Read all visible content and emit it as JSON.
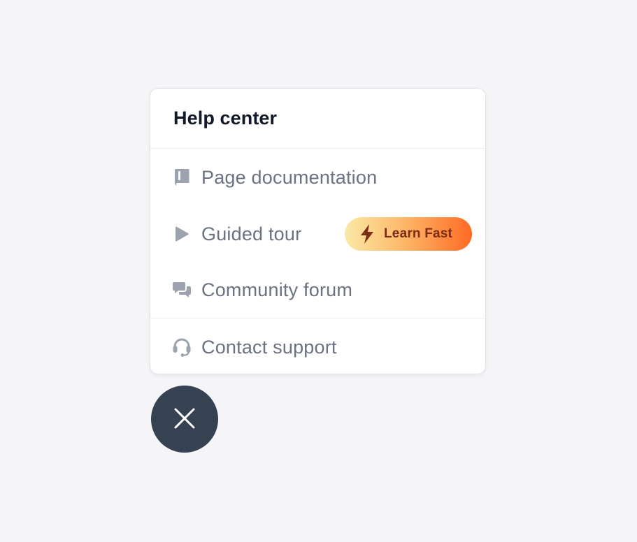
{
  "help_center": {
    "title": "Help center",
    "items": [
      {
        "label": "Page documentation",
        "icon": "book-icon"
      },
      {
        "label": "Guided tour",
        "icon": "play-icon",
        "badge": {
          "label": "Learn Fast",
          "icon": "lightning-bolt-icon"
        }
      },
      {
        "label": "Community forum",
        "icon": "chat-bubbles-icon"
      }
    ],
    "support_items": [
      {
        "label": "Contact support",
        "icon": "headset-icon"
      }
    ]
  },
  "close_button": {
    "icon": "close-icon"
  },
  "colors": {
    "background": "#f5f5f7",
    "panel": "#ffffff",
    "title_text": "#111827",
    "item_text": "#6b7280",
    "icon": "#9ca3af",
    "badge_gradient_start": "#fbe9a6",
    "badge_gradient_end": "#ff6a24",
    "badge_text": "#7c2d12",
    "fab": "#364152"
  }
}
